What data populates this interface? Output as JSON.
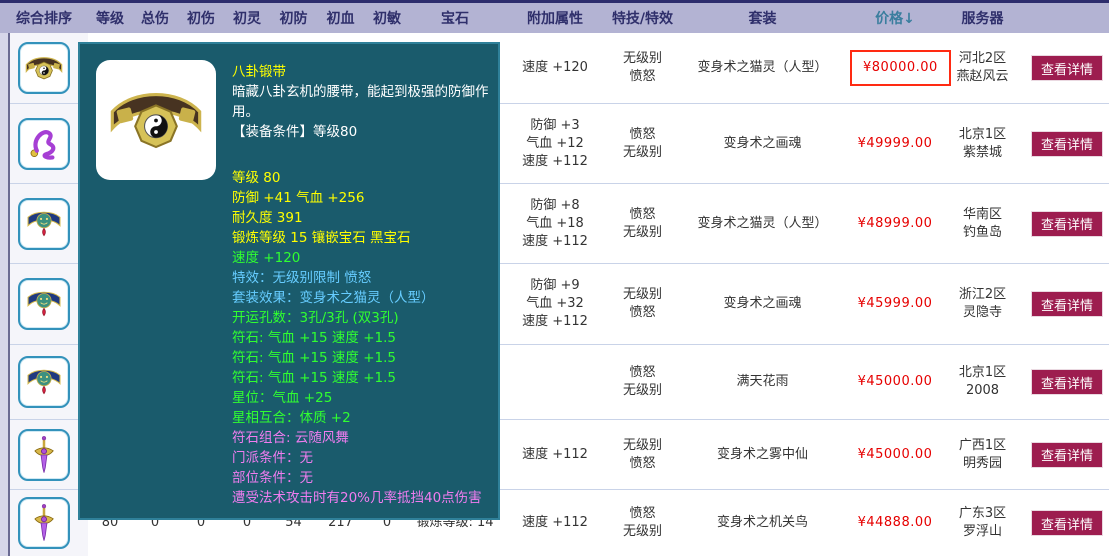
{
  "colors": {
    "header_bg": "#b3b3d3",
    "sorted_col": "#3a7e9e",
    "tooltip_bg": "#1a5b6c",
    "price_red": "#e60000",
    "button_bg": "#9d1d4f",
    "stat_yellow": "#ffff00",
    "stat_green": "#30ff30",
    "stat_blue": "#66ccff",
    "stat_violet": "#f07df0"
  },
  "header": {
    "columns": {
      "sort": "综合排序",
      "level": "等级",
      "zongshang": "总伤",
      "chushang": "初伤",
      "chuling": "初灵",
      "chufang": "初防",
      "chuxue": "初血",
      "chumin": "初敏",
      "gem": "宝石",
      "attrs": "附加属性",
      "effects": "特技/特效",
      "suit": "套装",
      "price": "价格",
      "price_sort_arrow": "↓",
      "server": "服务器"
    }
  },
  "tooltip": {
    "title": "八卦锻带",
    "desc": "暗藏八卦玄机的腰带，能起到极强的防御作用。",
    "condition": "【装备条件】等级80",
    "lines": [
      {
        "text": "等级 80",
        "color": "yellow"
      },
      {
        "text": "防御 +41 气血 +256",
        "color": "yellow"
      },
      {
        "text": "耐久度 391",
        "color": "yellow"
      },
      {
        "text": "锻炼等级 15 镶嵌宝石 黑宝石",
        "color": "yellow"
      },
      {
        "text": "速度 +120",
        "color": "green"
      },
      {
        "text": "特效：无级别限制 愤怒",
        "color": "blue"
      },
      {
        "text": "套装效果：变身术之猫灵（人型）",
        "color": "blue"
      },
      {
        "text": "开运孔数：3孔/3孔 (双3孔)",
        "color": "green"
      },
      {
        "text": "符石: 气血 +15 速度 +1.5",
        "color": "green"
      },
      {
        "text": "符石: 气血 +15 速度 +1.5",
        "color": "green"
      },
      {
        "text": "符石: 气血 +15 速度 +1.5",
        "color": "green"
      },
      {
        "text": "星位：气血 +25",
        "color": "green"
      },
      {
        "text": "星相互合：体质 +2",
        "color": "green"
      },
      {
        "text": "符石组合: 云随风舞",
        "color": "violet"
      },
      {
        "text": "门派条件：无",
        "color": "violet"
      },
      {
        "text": "部位条件：无",
        "color": "violet"
      },
      {
        "text": "遭受法术攻击时有20%几率抵挡40点伤害",
        "color": "violet"
      }
    ]
  },
  "rows": [
    {
      "icon": "bagua-belt",
      "stats": [
        "",
        "",
        "",
        "",
        "",
        "",
        ""
      ],
      "gem": "",
      "attrs": [
        "速度 +120"
      ],
      "effects": [
        "无级别",
        "愤怒"
      ],
      "suit": "变身术之猫灵（人型）",
      "price": "¥80000.00",
      "price_highlighted": true,
      "server": [
        "河北2区",
        "燕赵风云"
      ],
      "action": "查看详情"
    },
    {
      "icon": "purple-whip",
      "stats": [
        "",
        "",
        "",
        "",
        "",
        "",
        ""
      ],
      "gem": "",
      "attrs": [
        "防御 +3",
        "气血 +12",
        "速度 +112"
      ],
      "effects": [
        "愤怒",
        "无级别"
      ],
      "suit": "变身术之画魂",
      "price": "¥49999.00",
      "price_highlighted": false,
      "server": [
        "北京1区",
        "紫禁城"
      ],
      "action": "查看详情"
    },
    {
      "icon": "blue-belt",
      "stats": [
        "",
        "",
        "",
        "",
        "",
        "",
        ""
      ],
      "gem": "",
      "attrs": [
        "防御 +8",
        "气血 +18",
        "速度 +112"
      ],
      "effects": [
        "愤怒",
        "无级别"
      ],
      "suit": "变身术之猫灵（人型）",
      "price": "¥48999.00",
      "price_highlighted": false,
      "server": [
        "华南区",
        "钓鱼岛"
      ],
      "action": "查看详情"
    },
    {
      "icon": "blue-belt",
      "stats": [
        "",
        "",
        "",
        "",
        "",
        "",
        ""
      ],
      "gem": "",
      "attrs": [
        "防御 +9",
        "气血 +32",
        "速度 +112"
      ],
      "effects": [
        "无级别",
        "愤怒"
      ],
      "suit": "变身术之画魂",
      "price": "¥45999.00",
      "price_highlighted": false,
      "server": [
        "浙江2区",
        "灵隐寺"
      ],
      "action": "查看详情"
    },
    {
      "icon": "blue-belt",
      "stats": [
        "",
        "",
        "",
        "",
        "",
        "",
        ""
      ],
      "gem": "",
      "attrs": [],
      "effects": [
        "愤怒",
        "无级别"
      ],
      "suit": "满天花雨",
      "price": "¥45000.00",
      "price_highlighted": false,
      "server": [
        "北京1区",
        "2008"
      ],
      "action": "查看详情"
    },
    {
      "icon": "purple-sword",
      "stats": [
        "",
        "",
        "",
        "",
        "",
        "",
        ""
      ],
      "gem": "",
      "attrs": [
        "速度 +112"
      ],
      "effects": [
        "无级别",
        "愤怒"
      ],
      "suit": "变身术之雾中仙",
      "price": "¥45000.00",
      "price_highlighted": false,
      "server": [
        "广西1区",
        "明秀园"
      ],
      "action": "查看详情"
    },
    {
      "icon": "purple-sword",
      "stats": [
        "80",
        "0",
        "0",
        "0",
        "54",
        "217",
        "0"
      ],
      "gem": "锻炼等级: 14",
      "attrs": [
        "速度 +112"
      ],
      "effects": [
        "愤怒",
        "无级别"
      ],
      "suit": "变身术之机关鸟",
      "price": "¥44888.00",
      "price_highlighted": false,
      "server": [
        "广东3区",
        "罗浮山"
      ],
      "action": "查看详情"
    }
  ]
}
